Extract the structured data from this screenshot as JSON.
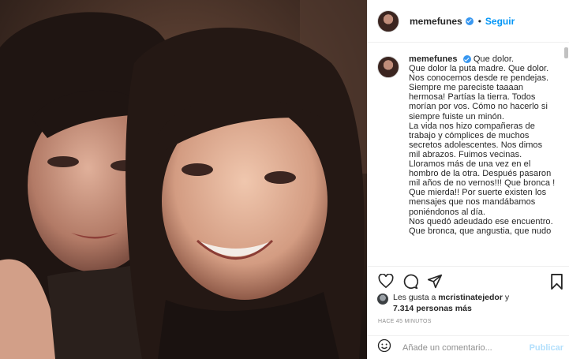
{
  "post": {
    "image_alt": "photo"
  },
  "header": {
    "username": "memefunes",
    "separator": "•",
    "follow_label": "Seguir"
  },
  "caption": {
    "username": "memefunes",
    "text": "Que dolor.\nQue dolor la puta madre. Que dolor.\nNos conocemos desde re pendejas.\nSiempre me pareciste taaaan hermosa! Partías la tierra. Todos morían por vos. Cómo no hacerlo si siempre fuiste un minón.\nLa vida nos hizo compañeras de trabajo y cómplices de muchos secretos adolescentes. Nos dimos mil abrazos. Fuimos vecinas. Lloramos más de una vez en el hombro de la otra. Después pasaron mil años de no vernos!!! Que bronca ! Que mierda!! Por suerte existen los mensajes que nos mandábamos poniéndonos al día.\nNos quedó adeudado ese encuentro.\nQue bronca, que angustia, que nudo"
  },
  "likes": {
    "prefix": "Les gusta a",
    "user": "mcristinatejedor",
    "connector": "y",
    "count": "7.314 personas más"
  },
  "timestamp": "HACE 45 MINUTOS",
  "comment": {
    "placeholder": "Añade un comentario...",
    "publish_label": "Publicar"
  },
  "colors": {
    "link_blue": "#0095f6",
    "verified_blue": "#3897f0",
    "publish_disabled": "#b2dffc",
    "muted_text": "#8e8e8e"
  }
}
